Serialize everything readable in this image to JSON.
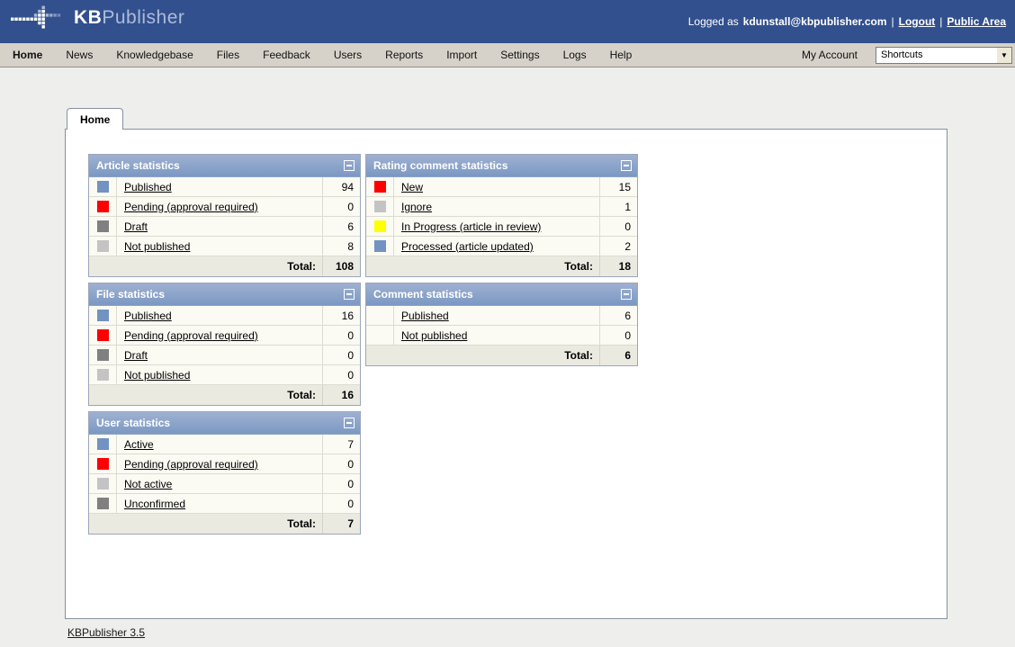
{
  "header": {
    "logo_kb": "KB",
    "logo_publisher": "Publisher",
    "logged_as_label": "Logged as",
    "user_email": "kdunstall@kbpublisher.com",
    "separator": "|",
    "logout_label": "Logout",
    "public_area_label": "Public Area"
  },
  "nav": {
    "items": [
      "Home",
      "News",
      "Knowledgebase",
      "Files",
      "Feedback",
      "Users",
      "Reports",
      "Import",
      "Settings",
      "Logs",
      "Help"
    ],
    "active": "Home",
    "my_account_label": "My Account",
    "shortcuts_value": "Shortcuts"
  },
  "tab": {
    "label": "Home"
  },
  "colors": {
    "header_blue": "#32508e",
    "panel_header_blue": "#7b98c3",
    "status_published_blue": "#7292c2",
    "status_pending_red": "#ff0000",
    "status_draft_gray": "#808080",
    "status_notpublished_lightgray": "#c4c4c4",
    "status_inprogress_yellow": "#ffff00"
  },
  "panels": [
    {
      "column": "left",
      "title": "Article statistics",
      "rows": [
        {
          "color": "#7292c2",
          "label": "Published",
          "value": "94"
        },
        {
          "color": "#ff0000",
          "label": "Pending (approval required)",
          "value": "0"
        },
        {
          "color": "#808080",
          "label": "Draft",
          "value": "6"
        },
        {
          "color": "#c4c4c4",
          "label": "Not published",
          "value": "8"
        }
      ],
      "total_label": "Total:",
      "total": "108"
    },
    {
      "column": "right",
      "title": "Rating comment statistics",
      "rows": [
        {
          "color": "#ff0000",
          "label": "New",
          "value": "15"
        },
        {
          "color": "#c4c4c4",
          "label": "Ignore",
          "value": "1"
        },
        {
          "color": "#ffff00",
          "label": "In Progress (article in review)",
          "value": "0"
        },
        {
          "color": "#7292c2",
          "label": "Processed (article updated)",
          "value": "2"
        }
      ],
      "total_label": "Total:",
      "total": "18"
    },
    {
      "column": "left",
      "title": "File statistics",
      "rows": [
        {
          "color": "#7292c2",
          "label": "Published",
          "value": "16"
        },
        {
          "color": "#ff0000",
          "label": "Pending (approval required)",
          "value": "0"
        },
        {
          "color": "#808080",
          "label": "Draft",
          "value": "0"
        },
        {
          "color": "#c4c4c4",
          "label": "Not published",
          "value": "0"
        }
      ],
      "total_label": "Total:",
      "total": "16"
    },
    {
      "column": "right",
      "title": "Comment statistics",
      "rows": [
        {
          "color": null,
          "label": "Published",
          "value": "6"
        },
        {
          "color": null,
          "label": "Not published",
          "value": "0"
        }
      ],
      "total_label": "Total:",
      "total": "6"
    },
    {
      "column": "left",
      "title": "User statistics",
      "rows": [
        {
          "color": "#7292c2",
          "label": "Active",
          "value": "7"
        },
        {
          "color": "#ff0000",
          "label": "Pending (approval required)",
          "value": "0"
        },
        {
          "color": "#c4c4c4",
          "label": "Not active",
          "value": "0"
        },
        {
          "color": "#808080",
          "label": "Unconfirmed",
          "value": "0"
        }
      ],
      "total_label": "Total:",
      "total": "7"
    }
  ],
  "footer": {
    "version_link": "KBPublisher 3.5"
  }
}
